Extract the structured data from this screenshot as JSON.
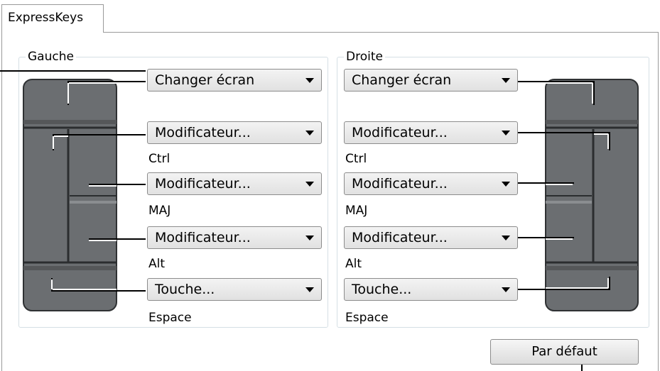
{
  "tab": {
    "label": "ExpressKeys"
  },
  "left": {
    "title": "Gauche",
    "dropdowns": [
      {
        "value": "Changer écran",
        "sub": ""
      },
      {
        "value": "Modificateur...",
        "sub": "Ctrl"
      },
      {
        "value": "Modificateur...",
        "sub": "MAJ"
      },
      {
        "value": "Modificateur...",
        "sub": "Alt"
      },
      {
        "value": "Touche...",
        "sub": "Espace"
      }
    ]
  },
  "right": {
    "title": "Droite",
    "dropdowns": [
      {
        "value": "Changer écran",
        "sub": ""
      },
      {
        "value": "Modificateur...",
        "sub": "Ctrl"
      },
      {
        "value": "Modificateur...",
        "sub": "MAJ"
      },
      {
        "value": "Modificateur...",
        "sub": "Alt"
      },
      {
        "value": "Touche...",
        "sub": "Espace"
      }
    ]
  },
  "default_button": "Par défaut"
}
